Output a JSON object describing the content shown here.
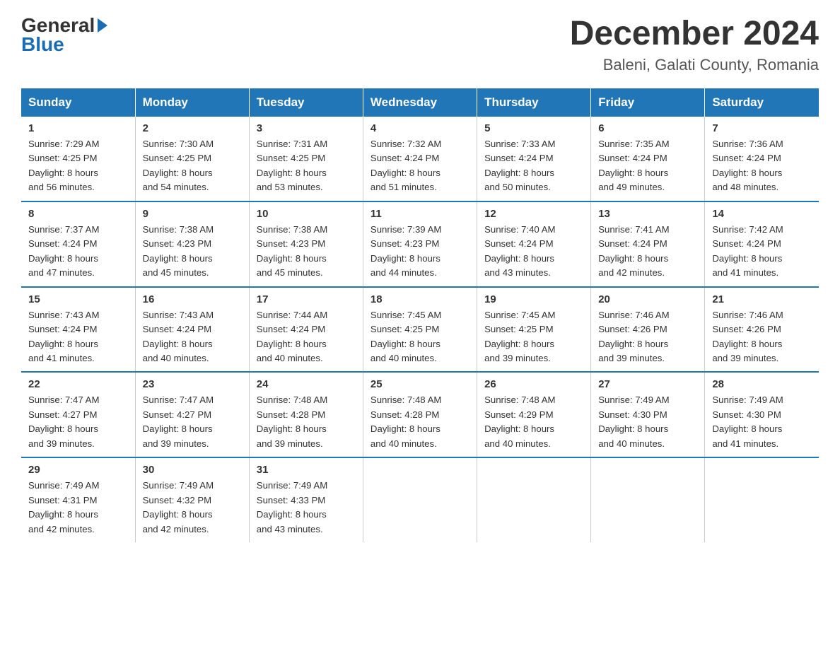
{
  "header": {
    "logo_general": "General",
    "logo_blue": "Blue",
    "month_title": "December 2024",
    "location": "Baleni, Galati County, Romania"
  },
  "days_of_week": [
    "Sunday",
    "Monday",
    "Tuesday",
    "Wednesday",
    "Thursday",
    "Friday",
    "Saturday"
  ],
  "weeks": [
    [
      {
        "day": "1",
        "sunrise": "7:29 AM",
        "sunset": "4:25 PM",
        "daylight": "8 hours and 56 minutes."
      },
      {
        "day": "2",
        "sunrise": "7:30 AM",
        "sunset": "4:25 PM",
        "daylight": "8 hours and 54 minutes."
      },
      {
        "day": "3",
        "sunrise": "7:31 AM",
        "sunset": "4:25 PM",
        "daylight": "8 hours and 53 minutes."
      },
      {
        "day": "4",
        "sunrise": "7:32 AM",
        "sunset": "4:24 PM",
        "daylight": "8 hours and 51 minutes."
      },
      {
        "day": "5",
        "sunrise": "7:33 AM",
        "sunset": "4:24 PM",
        "daylight": "8 hours and 50 minutes."
      },
      {
        "day": "6",
        "sunrise": "7:35 AM",
        "sunset": "4:24 PM",
        "daylight": "8 hours and 49 minutes."
      },
      {
        "day": "7",
        "sunrise": "7:36 AM",
        "sunset": "4:24 PM",
        "daylight": "8 hours and 48 minutes."
      }
    ],
    [
      {
        "day": "8",
        "sunrise": "7:37 AM",
        "sunset": "4:24 PM",
        "daylight": "8 hours and 47 minutes."
      },
      {
        "day": "9",
        "sunrise": "7:38 AM",
        "sunset": "4:23 PM",
        "daylight": "8 hours and 45 minutes."
      },
      {
        "day": "10",
        "sunrise": "7:38 AM",
        "sunset": "4:23 PM",
        "daylight": "8 hours and 45 minutes."
      },
      {
        "day": "11",
        "sunrise": "7:39 AM",
        "sunset": "4:23 PM",
        "daylight": "8 hours and 44 minutes."
      },
      {
        "day": "12",
        "sunrise": "7:40 AM",
        "sunset": "4:24 PM",
        "daylight": "8 hours and 43 minutes."
      },
      {
        "day": "13",
        "sunrise": "7:41 AM",
        "sunset": "4:24 PM",
        "daylight": "8 hours and 42 minutes."
      },
      {
        "day": "14",
        "sunrise": "7:42 AM",
        "sunset": "4:24 PM",
        "daylight": "8 hours and 41 minutes."
      }
    ],
    [
      {
        "day": "15",
        "sunrise": "7:43 AM",
        "sunset": "4:24 PM",
        "daylight": "8 hours and 41 minutes."
      },
      {
        "day": "16",
        "sunrise": "7:43 AM",
        "sunset": "4:24 PM",
        "daylight": "8 hours and 40 minutes."
      },
      {
        "day": "17",
        "sunrise": "7:44 AM",
        "sunset": "4:24 PM",
        "daylight": "8 hours and 40 minutes."
      },
      {
        "day": "18",
        "sunrise": "7:45 AM",
        "sunset": "4:25 PM",
        "daylight": "8 hours and 40 minutes."
      },
      {
        "day": "19",
        "sunrise": "7:45 AM",
        "sunset": "4:25 PM",
        "daylight": "8 hours and 39 minutes."
      },
      {
        "day": "20",
        "sunrise": "7:46 AM",
        "sunset": "4:26 PM",
        "daylight": "8 hours and 39 minutes."
      },
      {
        "day": "21",
        "sunrise": "7:46 AM",
        "sunset": "4:26 PM",
        "daylight": "8 hours and 39 minutes."
      }
    ],
    [
      {
        "day": "22",
        "sunrise": "7:47 AM",
        "sunset": "4:27 PM",
        "daylight": "8 hours and 39 minutes."
      },
      {
        "day": "23",
        "sunrise": "7:47 AM",
        "sunset": "4:27 PM",
        "daylight": "8 hours and 39 minutes."
      },
      {
        "day": "24",
        "sunrise": "7:48 AM",
        "sunset": "4:28 PM",
        "daylight": "8 hours and 39 minutes."
      },
      {
        "day": "25",
        "sunrise": "7:48 AM",
        "sunset": "4:28 PM",
        "daylight": "8 hours and 40 minutes."
      },
      {
        "day": "26",
        "sunrise": "7:48 AM",
        "sunset": "4:29 PM",
        "daylight": "8 hours and 40 minutes."
      },
      {
        "day": "27",
        "sunrise": "7:49 AM",
        "sunset": "4:30 PM",
        "daylight": "8 hours and 40 minutes."
      },
      {
        "day": "28",
        "sunrise": "7:49 AM",
        "sunset": "4:30 PM",
        "daylight": "8 hours and 41 minutes."
      }
    ],
    [
      {
        "day": "29",
        "sunrise": "7:49 AM",
        "sunset": "4:31 PM",
        "daylight": "8 hours and 42 minutes."
      },
      {
        "day": "30",
        "sunrise": "7:49 AM",
        "sunset": "4:32 PM",
        "daylight": "8 hours and 42 minutes."
      },
      {
        "day": "31",
        "sunrise": "7:49 AM",
        "sunset": "4:33 PM",
        "daylight": "8 hours and 43 minutes."
      },
      null,
      null,
      null,
      null
    ]
  ],
  "labels": {
    "sunrise": "Sunrise:",
    "sunset": "Sunset:",
    "daylight": "Daylight:"
  }
}
